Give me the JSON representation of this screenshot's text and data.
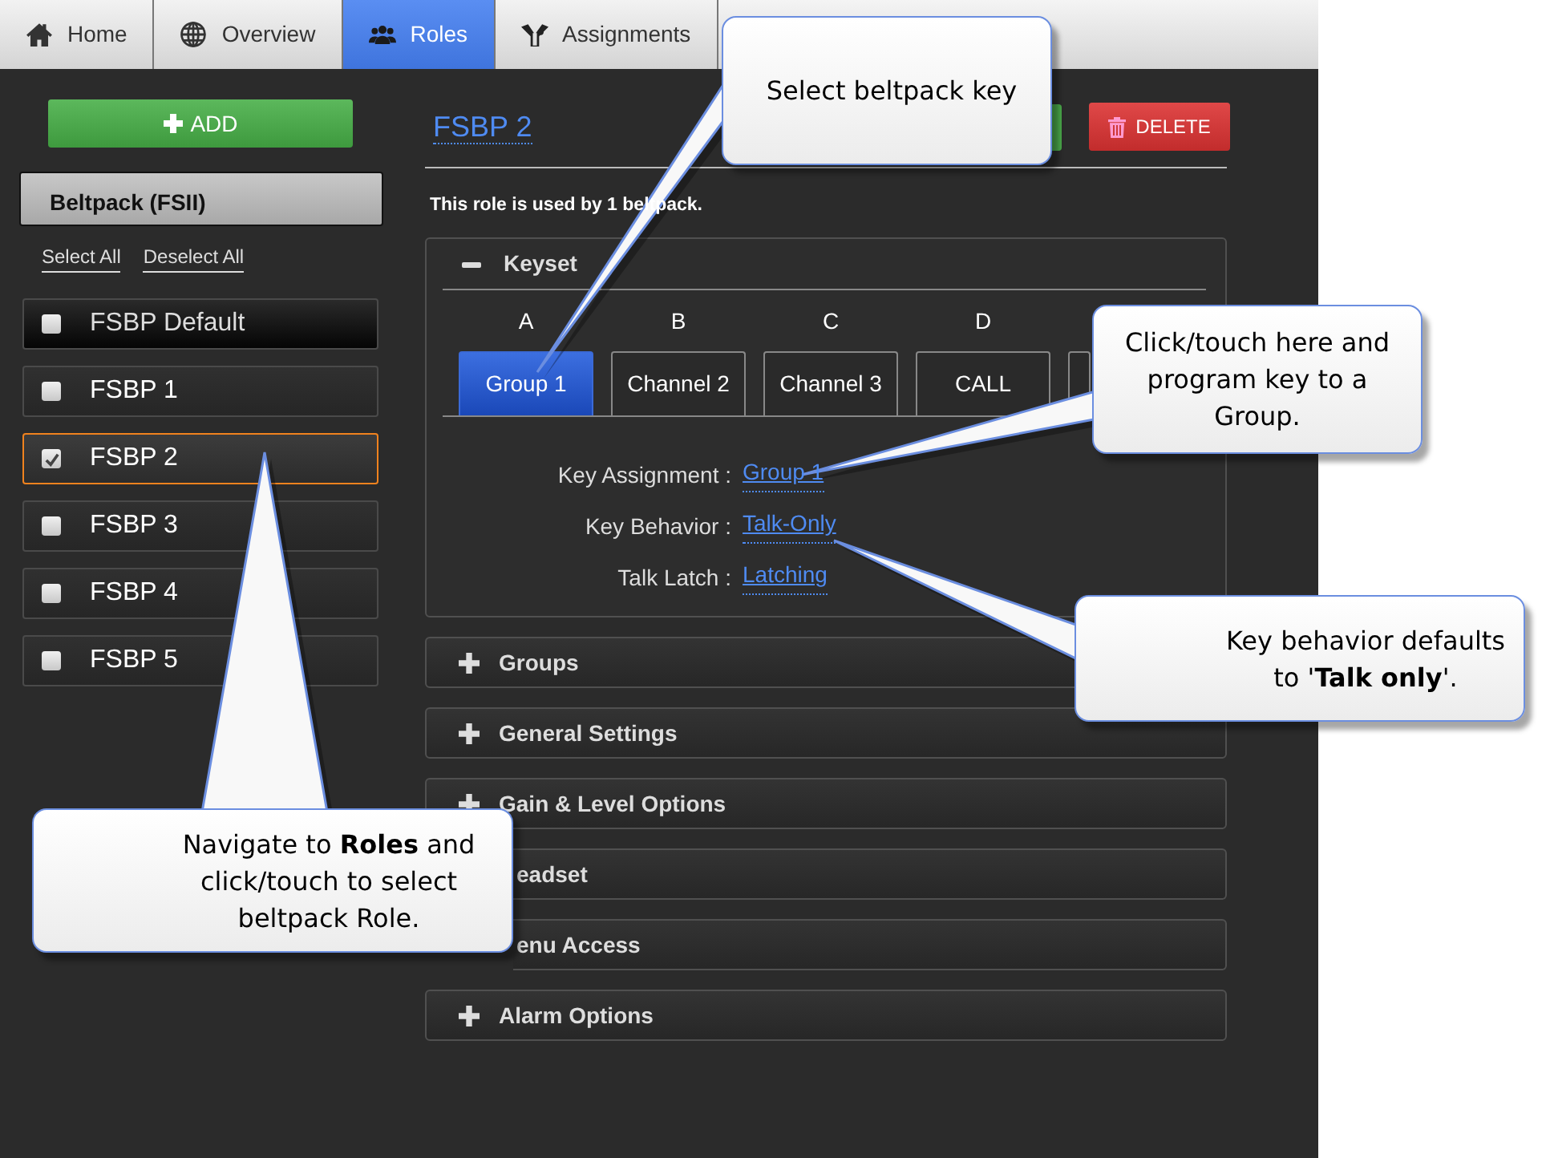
{
  "nav_tabs": [
    {
      "label": "Home",
      "selected": false
    },
    {
      "label": "Overview",
      "selected": false
    },
    {
      "label": "Roles",
      "selected": true
    },
    {
      "label": "Assignments",
      "selected": false
    }
  ],
  "sidebar": {
    "add_button": "ADD",
    "device_header": "Beltpack (FSII)",
    "select_all": "Select All",
    "deselect_all": "Deselect All",
    "roles": [
      {
        "name": "FSBP Default",
        "kind": "default",
        "checked": false,
        "selected": false
      },
      {
        "name": "FSBP 1",
        "kind": "custom",
        "checked": false,
        "selected": false
      },
      {
        "name": "FSBP 2",
        "kind": "custom",
        "checked": true,
        "selected": true
      },
      {
        "name": "FSBP 3",
        "kind": "custom",
        "checked": false,
        "selected": false
      },
      {
        "name": "FSBP 4",
        "kind": "custom",
        "checked": false,
        "selected": false
      },
      {
        "name": "FSBP 5",
        "kind": "custom",
        "checked": false,
        "selected": false
      }
    ]
  },
  "role": {
    "title": "FSBP 2",
    "delete_button": "DELETE",
    "usage_note": "This role is used by 1 beltpack."
  },
  "keyset": {
    "title": "Keyset",
    "expanded": true,
    "keys": [
      {
        "letter": "A",
        "label": "Group 1",
        "selected": true
      },
      {
        "letter": "B",
        "label": "Channel 2",
        "selected": false
      },
      {
        "letter": "C",
        "label": "Channel 3",
        "selected": false
      },
      {
        "letter": "D",
        "label": "CALL",
        "selected": false
      },
      {
        "selected": false
      }
    ],
    "properties": [
      {
        "label": "Key Assignment :",
        "value": "Group 1"
      },
      {
        "label": "Key Behavior :",
        "value": "Talk-Only"
      },
      {
        "label": "Talk Latch :",
        "value": "Latching"
      }
    ]
  },
  "panels": [
    {
      "title": "Groups",
      "kind": "panel",
      "expanded": false
    },
    {
      "title": "General Settings",
      "kind": "panel",
      "expanded": false
    },
    {
      "title": "Gain & Level Options",
      "kind": "panel",
      "expanded": false
    },
    {
      "title": "eadset",
      "kind": "covered"
    },
    {
      "title": "enu Access",
      "kind": "covered"
    },
    {
      "title": "Alarm Options",
      "kind": "panel",
      "expanded": false
    }
  ],
  "callouts": [
    {
      "text": "Select beltpack key"
    },
    {
      "text": "Click/touch here and program key to a Group."
    },
    {
      "text": "Key behavior defaults to '**Talk only**'."
    },
    {
      "text": "Navigate to **Roles** and click/touch to select beltpack Role."
    }
  ]
}
